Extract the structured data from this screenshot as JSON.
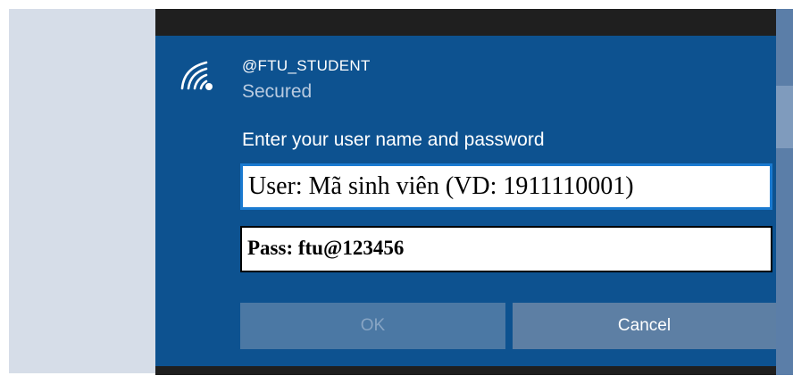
{
  "network": {
    "ssid": "@FTU_STUDENT",
    "status": "Secured",
    "icon": "wifi-secured-icon"
  },
  "auth": {
    "prompt": "Enter your user name and password",
    "username_value": "User: Mã sinh viên (VD: 1911110001)",
    "password_value": "Pass: ftu@123456"
  },
  "buttons": {
    "ok_label": "OK",
    "ok_enabled": false,
    "cancel_label": "Cancel"
  },
  "colors": {
    "flyout_background": "#0d5290",
    "focus_border": "#1a7ad0",
    "side_background": "#d6dde8"
  }
}
